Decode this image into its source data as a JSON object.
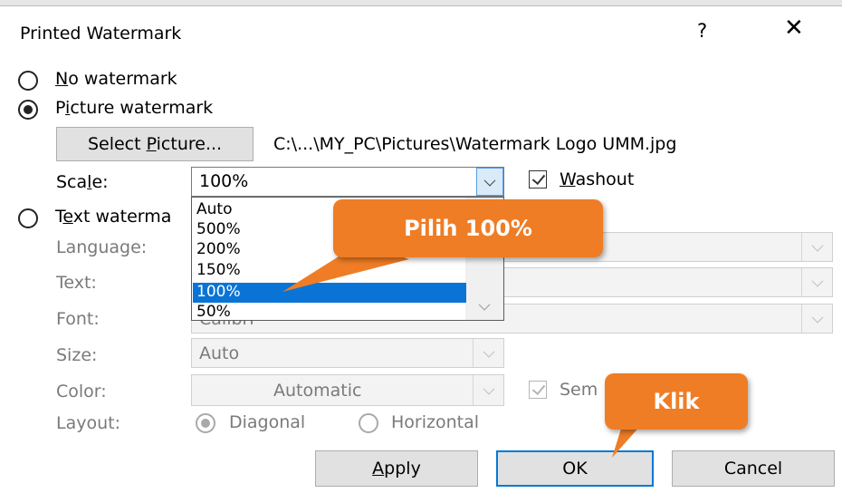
{
  "dialog": {
    "title": "Printed Watermark",
    "help_label": "?",
    "close_label": "✕"
  },
  "options": {
    "no_watermark_label": "No watermark",
    "picture_watermark_label": "Picture watermark",
    "text_watermark_label": "Text waterma",
    "selected": "picture"
  },
  "picture": {
    "select_button_label": "Select Picture...",
    "file_path": "C:\\...\\MY_PC\\Pictures\\Watermark Logo UMM.jpg",
    "scale_label": "Scale:",
    "scale_value": "100%",
    "scale_options": [
      "Auto",
      "500%",
      "200%",
      "150%",
      "100%",
      "50%"
    ],
    "selected_option": "100%",
    "washout_label": "Washout",
    "washout_checked": true
  },
  "text_section": {
    "language_label": "Language:",
    "text_label": "Text:",
    "font_label": "Font:",
    "font_value": "Calibri",
    "size_label": "Size:",
    "size_value": "Auto",
    "color_label": "Color:",
    "color_value": "Automatic",
    "semi_label": "Sem",
    "layout_label": "Layout:",
    "diagonal_label": "Diagonal",
    "horizontal_label": "Horizontal"
  },
  "buttons": {
    "apply_label": "Apply",
    "ok_label": "OK",
    "cancel_label": "Cancel"
  },
  "annotations": {
    "callout_scale": "Pilih 100%",
    "callout_ok": "Klik",
    "callout_color": "#ef7d25"
  }
}
